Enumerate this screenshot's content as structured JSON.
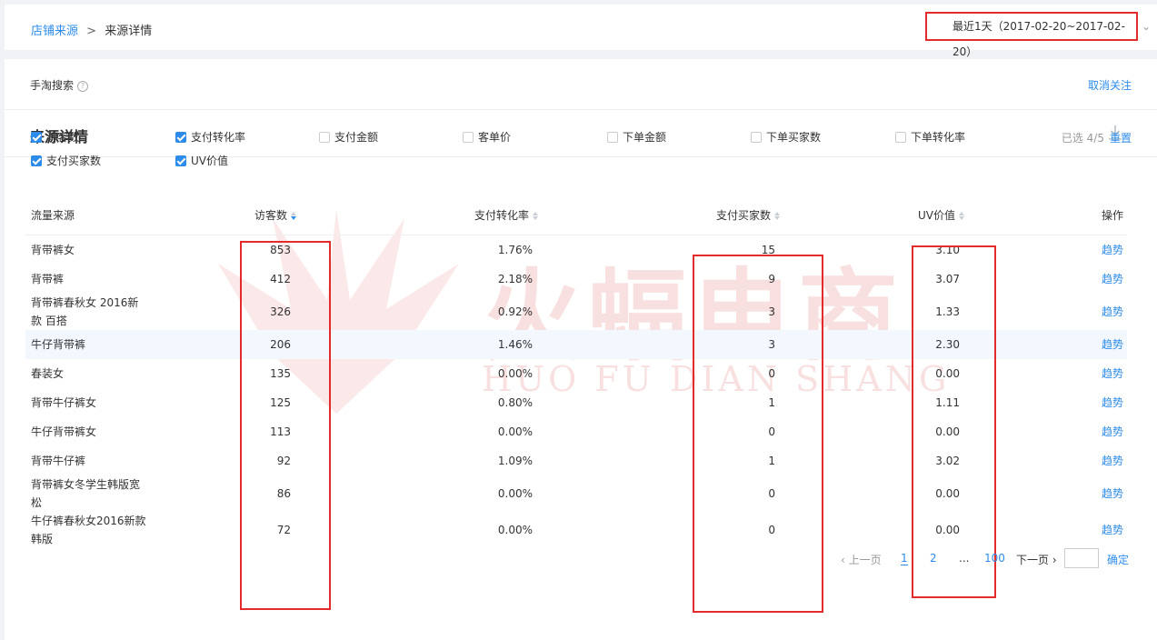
{
  "header": {
    "breadcrumb_parent": "店铺来源",
    "breadcrumb_sep": ">",
    "breadcrumb_current": "来源详情",
    "date_range": "最近1天（2017-02-20~2017-02-20）"
  },
  "source": {
    "name": "手淘搜索",
    "help_icon": "?",
    "unfollow": "取消关注"
  },
  "section": {
    "title": "来源详情"
  },
  "metrics": [
    {
      "label": "访客数",
      "checked": true
    },
    {
      "label": "支付转化率",
      "checked": true
    },
    {
      "label": "支付金额",
      "checked": false
    },
    {
      "label": "客单价",
      "checked": false
    },
    {
      "label": "下单金额",
      "checked": false
    },
    {
      "label": "下单买家数",
      "checked": false
    },
    {
      "label": "下单转化率",
      "checked": false
    },
    {
      "label": "支付买家数",
      "checked": true
    },
    {
      "label": "UV价值",
      "checked": true
    }
  ],
  "selection": {
    "count": "已选 4/5",
    "reset": "重置"
  },
  "table": {
    "headers": [
      "流量来源",
      "访客数",
      "支付转化率",
      "支付买家数",
      "UV价值",
      "操作"
    ],
    "rows": [
      {
        "name": "背带裤女",
        "visitors": "853",
        "conv": "1.76%",
        "buyers": "15",
        "uv": "3.10",
        "action": "趋势"
      },
      {
        "name": "背带裤",
        "visitors": "412",
        "conv": "2.18%",
        "buyers": "9",
        "uv": "3.07",
        "action": "趋势"
      },
      {
        "name": "背带裤春秋女 2016新款 百搭",
        "visitors": "326",
        "conv": "0.92%",
        "buyers": "3",
        "uv": "1.33",
        "action": "趋势"
      },
      {
        "name": "牛仔背带裤",
        "visitors": "206",
        "conv": "1.46%",
        "buyers": "3",
        "uv": "2.30",
        "action": "趋势"
      },
      {
        "name": "春装女",
        "visitors": "135",
        "conv": "0.00%",
        "buyers": "0",
        "uv": "0.00",
        "action": "趋势"
      },
      {
        "name": "背带牛仔裤女",
        "visitors": "125",
        "conv": "0.80%",
        "buyers": "1",
        "uv": "1.11",
        "action": "趋势"
      },
      {
        "name": "牛仔背带裤女",
        "visitors": "113",
        "conv": "0.00%",
        "buyers": "0",
        "uv": "0.00",
        "action": "趋势"
      },
      {
        "name": "背带牛仔裤",
        "visitors": "92",
        "conv": "1.09%",
        "buyers": "1",
        "uv": "3.02",
        "action": "趋势"
      },
      {
        "name": "背带裤女冬学生韩版宽松",
        "visitors": "86",
        "conv": "0.00%",
        "buyers": "0",
        "uv": "0.00",
        "action": "趋势"
      },
      {
        "name": "牛仔裤春秋女2016新款 韩版",
        "visitors": "72",
        "conv": "0.00%",
        "buyers": "0",
        "uv": "0.00",
        "action": "趋势"
      }
    ]
  },
  "pagination": {
    "prev": "上一页",
    "pages": [
      "1",
      "2",
      "...",
      "100"
    ],
    "next": "下一页",
    "confirm": "确定"
  },
  "watermark": {
    "title": "火蝠电商",
    "subtitle": "HUO FU DIAN SHANG"
  },
  "colors": {
    "accent": "#2d8ceb",
    "highlight": "#e32b2b"
  }
}
